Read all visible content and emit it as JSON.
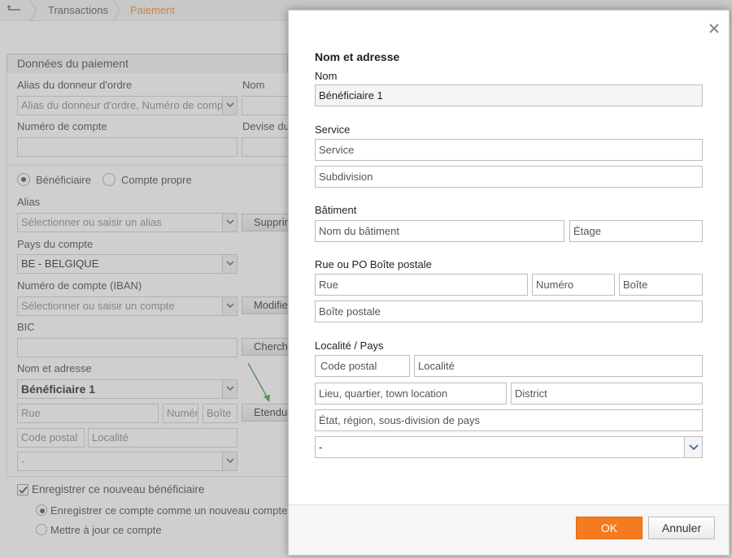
{
  "breadcrumb": {
    "items": [
      "Transactions",
      "Paiement"
    ]
  },
  "background": {
    "section_title": "Données du paiement",
    "alias_label": "Alias du donneur d'ordre",
    "alias_placeholder": "Alias du donneur d'ordre, Numéro de compte",
    "nom_label": "Nom",
    "account_label": "Numéro de compte",
    "currency_label": "Devise du",
    "radio_beneficiaire": "Bénéficiaire",
    "radio_compte_propre": "Compte propre",
    "alias2_label": "Alias",
    "alias2_placeholder": "Sélectionner ou saisir un alias",
    "delete_button": "Supprimer",
    "country_label": "Pays du compte",
    "country_value": "BE - BELGIQUE",
    "iban_label": "Numéro de compte (IBAN)",
    "iban_placeholder": "Sélectionner ou saisir un compte",
    "modify_button": "Modifier",
    "bic_label": "BIC",
    "search_button": "Chercher",
    "name_address_label": "Nom et adresse",
    "name_value": "Bénéficiaire 1",
    "street_placeholder": "Rue",
    "number_placeholder": "Numéro",
    "box_placeholder": "Boîte",
    "extend_button": "Etendu",
    "postal_placeholder": "Code postal",
    "city_placeholder": "Localité",
    "country2_value": "-",
    "save_checkbox_label": "Enregistrer ce nouveau bénéficiaire",
    "save_new_account_label": "Enregistrer ce compte comme un nouveau compte",
    "update_account_label": "Mettre à jour ce compte"
  },
  "modal": {
    "title": "Nom et adresse",
    "nom_label": "Nom",
    "nom_value": "Bénéficiaire 1",
    "service_label": "Service",
    "service_placeholder": "Service",
    "subdivision_placeholder": "Subdivision",
    "building_label": "Bâtiment",
    "building_placeholder": "Nom du bâtiment",
    "floor_placeholder": "Étage",
    "street_label": "Rue ou PO Boîte postale",
    "street_placeholder": "Rue",
    "number_placeholder": "Numéro",
    "box_placeholder": "Boîte",
    "po_box_placeholder": "Boîte postale",
    "city_label": "Localité / Pays",
    "postal_placeholder": "Code postal",
    "city_placeholder": "Localité",
    "location_placeholder": "Lieu, quartier, town location",
    "district_placeholder": "District",
    "region_placeholder": "État, région, sous-division de pays",
    "country_value": "-",
    "ok_button": "OK",
    "cancel_button": "Annuler"
  },
  "colors": {
    "accent": "#f47b20",
    "breadcrumb_active": "#e8893a"
  }
}
